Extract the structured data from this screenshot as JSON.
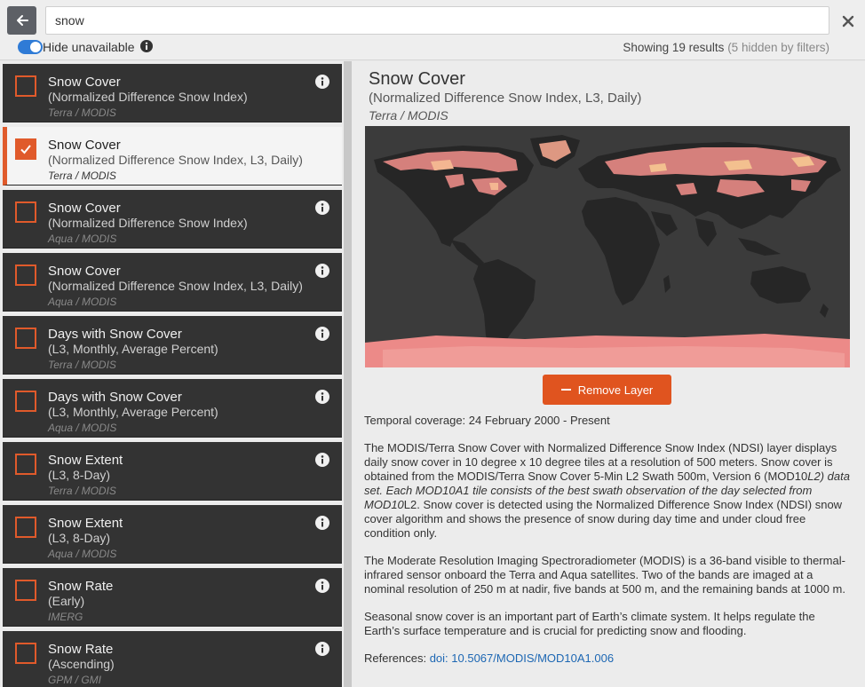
{
  "search": {
    "value": "snow"
  },
  "filters": {
    "hide_label": "Hide unavailable",
    "results_text": "Showing 19 results",
    "hidden_text": "(5 hidden by filters)"
  },
  "layers": [
    {
      "title": "Snow Cover",
      "subtitle": "(Normalized Difference Snow Index)",
      "source": "Terra / MODIS",
      "checked": false
    },
    {
      "title": "Snow Cover",
      "subtitle": "(Normalized Difference Snow Index, L3, Daily)",
      "source": "Terra / MODIS",
      "checked": true
    },
    {
      "title": "Snow Cover",
      "subtitle": "(Normalized Difference Snow Index)",
      "source": "Aqua / MODIS",
      "checked": false
    },
    {
      "title": "Snow Cover",
      "subtitle": "(Normalized Difference Snow Index, L3, Daily)",
      "source": "Aqua / MODIS",
      "checked": false
    },
    {
      "title": "Days with Snow Cover",
      "subtitle": "(L3, Monthly, Average Percent)",
      "source": "Terra / MODIS",
      "checked": false
    },
    {
      "title": "Days with Snow Cover",
      "subtitle": "(L3, Monthly, Average Percent)",
      "source": "Aqua / MODIS",
      "checked": false
    },
    {
      "title": "Snow Extent",
      "subtitle": "(L3, 8-Day)",
      "source": "Terra / MODIS",
      "checked": false
    },
    {
      "title": "Snow Extent",
      "subtitle": "(L3, 8-Day)",
      "source": "Aqua / MODIS",
      "checked": false
    },
    {
      "title": "Snow Rate",
      "subtitle": "(Early)",
      "source": "IMERG",
      "checked": false
    },
    {
      "title": "Snow Rate",
      "subtitle": "(Ascending)",
      "source": "GPM / GMI",
      "checked": false
    }
  ],
  "detail": {
    "title": "Snow Cover",
    "subtitle": "(Normalized Difference Snow Index, L3, Daily)",
    "source": "Terra / MODIS",
    "remove_label": "Remove Layer",
    "temporal": "Temporal coverage: 24 February 2000 - Present",
    "para1_a": "The MODIS/Terra Snow Cover with Normalized Difference Snow Index (NDSI) layer displays daily snow cover in 10 degree x 10 degree tiles at a resolution of 500 meters. Snow cover is obtained from the MODIS/Terra Snow Cover 5-Min L2 Swath 500m, Version 6 (MOD10",
    "para1_b": "L2) data set. Each MOD10A1 tile consists of the best swath observation of the day selected from MOD10",
    "para1_c": "L2. Snow cover is detected using the Normalized Difference Snow Index (NDSI) snow cover algorithm and shows the presence of snow during day time and under cloud free condition only.",
    "para2": "The Moderate Resolution Imaging Spectroradiometer (MODIS) is a 36-band visible to thermal-infrared sensor onboard the Terra and Aqua satellites. Two of the bands are imaged at a nominal resolution of 250 m at nadir, five bands at 500 m, and the remaining bands at 1000 m.",
    "para3": "Seasonal snow cover is an important part of Earth’s climate system. It helps regulate the Earth’s surface temperature and is crucial for predicting snow and flooding.",
    "references_label": "References: ",
    "reference_link": "doi: 10.5067/MODIS/MOD10A1.006"
  },
  "colors": {
    "accent": "#e0541f",
    "toggle": "#2f7bd6",
    "list_bg": "#333333",
    "link": "#1d67b3"
  }
}
